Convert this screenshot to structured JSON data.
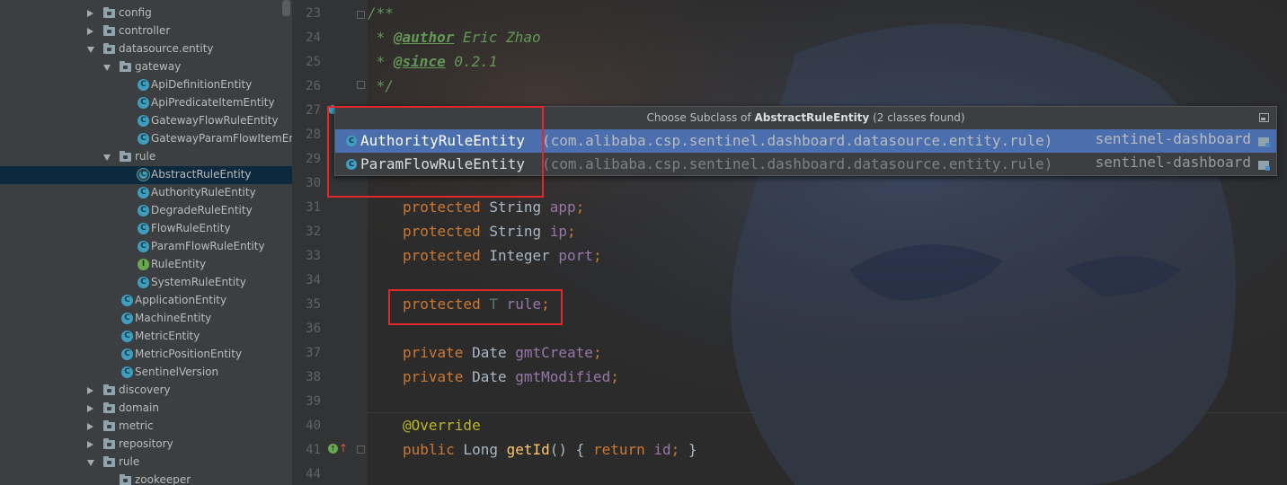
{
  "project_tree": {
    "items": [
      {
        "label": "config",
        "kind": "folder",
        "state": "collapsed",
        "depth": 0
      },
      {
        "label": "controller",
        "kind": "folder",
        "state": "collapsed",
        "depth": 0
      },
      {
        "label": "datasource.entity",
        "kind": "folder",
        "state": "expanded",
        "depth": 0
      },
      {
        "label": "gateway",
        "kind": "folder",
        "state": "expanded",
        "depth": 1
      },
      {
        "label": "ApiDefinitionEntity",
        "kind": "class",
        "depth": 2
      },
      {
        "label": "ApiPredicateItemEntity",
        "kind": "class",
        "depth": 2
      },
      {
        "label": "GatewayFlowRuleEntity",
        "kind": "class",
        "depth": 2
      },
      {
        "label": "GatewayParamFlowItemEnt",
        "kind": "class",
        "depth": 2
      },
      {
        "label": "rule",
        "kind": "folder",
        "state": "expanded",
        "depth": 1
      },
      {
        "label": "AbstractRuleEntity",
        "kind": "abstract-class",
        "depth": 2,
        "selected": true
      },
      {
        "label": "AuthorityRuleEntity",
        "kind": "class",
        "depth": 2
      },
      {
        "label": "DegradeRuleEntity",
        "kind": "class",
        "depth": 2
      },
      {
        "label": "FlowRuleEntity",
        "kind": "class",
        "depth": 2
      },
      {
        "label": "ParamFlowRuleEntity",
        "kind": "class",
        "depth": 2
      },
      {
        "label": "RuleEntity",
        "kind": "interface",
        "depth": 2
      },
      {
        "label": "SystemRuleEntity",
        "kind": "class",
        "depth": 2
      },
      {
        "label": "ApplicationEntity",
        "kind": "class",
        "depth": 1
      },
      {
        "label": "MachineEntity",
        "kind": "class",
        "depth": 1
      },
      {
        "label": "MetricEntity",
        "kind": "class",
        "depth": 1
      },
      {
        "label": "MetricPositionEntity",
        "kind": "class",
        "depth": 1
      },
      {
        "label": "SentinelVersion",
        "kind": "class",
        "depth": 1
      },
      {
        "label": "discovery",
        "kind": "folder",
        "state": "collapsed",
        "depth": 0
      },
      {
        "label": "domain",
        "kind": "folder",
        "state": "collapsed",
        "depth": 0
      },
      {
        "label": "metric",
        "kind": "folder",
        "state": "collapsed",
        "depth": 0
      },
      {
        "label": "repository",
        "kind": "folder",
        "state": "collapsed",
        "depth": 0
      },
      {
        "label": "rule",
        "kind": "folder",
        "state": "expanded",
        "depth": 0
      },
      {
        "label": "zookeeper",
        "kind": "folder",
        "state": "none",
        "depth": 1
      }
    ]
  },
  "editor": {
    "line_numbers": [
      "23",
      "24",
      "25",
      "26",
      "27",
      "28",
      "29",
      "30",
      "31",
      "32",
      "33",
      "34",
      "35",
      "36",
      "37",
      "38",
      "39",
      "40",
      "41",
      "44"
    ],
    "code": {
      "l23": "/**",
      "l24_star": " * ",
      "l24_tag": "@author",
      "l24_text": " Eric Zhao",
      "l25_star": " * ",
      "l25_tag": "@since",
      "l25_text": " 0.2.1",
      "l26": " */",
      "l31_kw": "protected",
      "l31_type": " String ",
      "l31_field": "app",
      "l31_end": ";",
      "l32_kw": "protected",
      "l32_type": " String ",
      "l32_field": "ip",
      "l32_end": ";",
      "l33_kw": "protected",
      "l33_type": " Integer ",
      "l33_field": "port",
      "l33_end": ";",
      "l35_kw": "protected",
      "l35_type": " T ",
      "l35_field": "rule",
      "l35_end": ";",
      "l37_kw": "private",
      "l37_type": " Date ",
      "l37_field": "gmtCreate",
      "l37_end": ";",
      "l38_kw": "private",
      "l38_type": " Date ",
      "l38_field": "gmtModified",
      "l38_end": ";",
      "l40": "@Override",
      "l41_kw": "public",
      "l41_type": " Long ",
      "l41_fn": "getId",
      "l41_paren": "() ",
      "l41_lbrace": "{",
      "l41_return": " return",
      "l41_field": " id",
      "l41_semi": "; ",
      "l41_rbrace": "}"
    }
  },
  "popup": {
    "title_prefix": "Choose Subclass of ",
    "title_class": "AbstractRuleEntity",
    "title_suffix": " (2 classes found)",
    "rows": [
      {
        "class": "AuthorityRuleEntity",
        "package": "(com.alibaba.csp.sentinel.dashboard.datasource.entity.rule)",
        "module": "sentinel-dashboard",
        "selected": true
      },
      {
        "class": "ParamFlowRuleEntity",
        "package": "(com.alibaba.csp.sentinel.dashboard.datasource.entity.rule)",
        "module": "sentinel-dashboard",
        "selected": false
      }
    ]
  },
  "icons": {
    "class_icon_letter": "C",
    "interface_icon_letter": "I"
  },
  "colors": {
    "tree_bg": "#3c3f41",
    "editor_bg": "#2b2b2b",
    "selection": "#4b6eaf",
    "highlight_box": "#e0272a",
    "keyword": "#cc7832",
    "field": "#9876aa",
    "doc_comment": "#629755"
  }
}
